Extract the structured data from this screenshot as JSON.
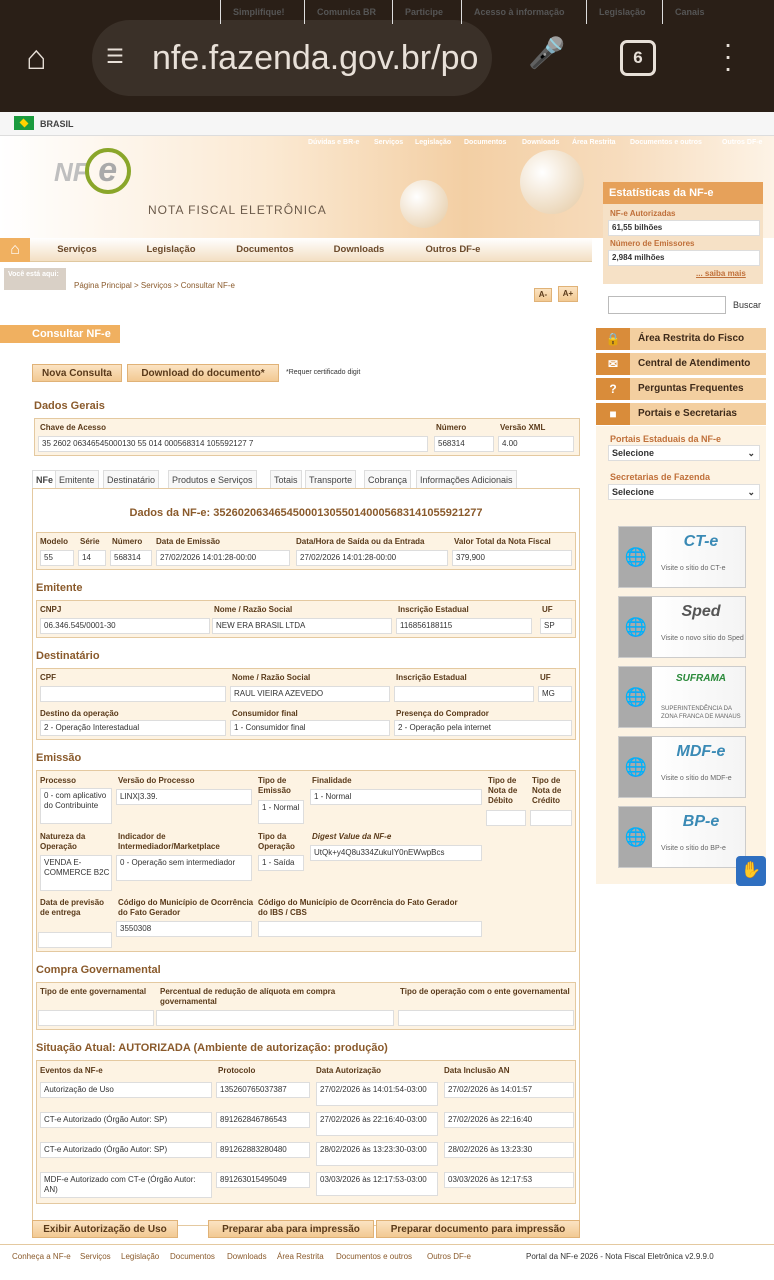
{
  "browser": {
    "url": "nfe.fazenda.gov.br/po",
    "tab_count": "6"
  },
  "govbar": {
    "country": "BRASIL",
    "links": [
      "Simplifique!",
      "Comunica BR",
      "Participe",
      "Acesso à informação",
      "Legislação",
      "Canais"
    ]
  },
  "toplinks": [
    "Dúvidas e BR-e",
    "Serviços",
    "Legislação",
    "Documentos",
    "Downloads",
    "Área Restrita",
    "Documentos e outros",
    "Outros DF-e"
  ],
  "logo": {
    "mark": "NF",
    "mark2": "e",
    "subtitle": "NOTA FISCAL ELETRÔNICA"
  },
  "stats": {
    "title": "Estatísticas da NF-e",
    "auth_label": "NF-e Autorizadas",
    "auth_value": "61,55 bilhões",
    "emit_label": "Número de Emissores",
    "emit_value": "2,984 milhões",
    "more": "... saiba mais"
  },
  "nav": [
    "Serviços",
    "Legislação",
    "Documentos",
    "Downloads",
    "Outros DF-e"
  ],
  "breadcrumb": {
    "here": "Você está aqui:",
    "path": "Página Principal > Serviços > Consultar NF-e"
  },
  "font": {
    "dec": "A-",
    "inc": "A+"
  },
  "search": {
    "placeholder": "",
    "button": "Buscar"
  },
  "page_title": "Consultar NF-e",
  "actions": {
    "new": "Nova Consulta",
    "download": "Download do documento*",
    "note": "*Requer certificado digit"
  },
  "gerais": {
    "title": "Dados Gerais",
    "chave_lbl": "Chave de Acesso",
    "chave": "35 2602 06346545000130 55 014 000568314 105592127 7",
    "numero_lbl": "Número",
    "numero": "568314",
    "versao_lbl": "Versão XML",
    "versao": "4.00"
  },
  "tabs": [
    "NFe",
    "Emitente",
    "Destinatário",
    "Produtos e Serviços",
    "Totais",
    "Transporte",
    "Cobrança",
    "Informações Adicionais"
  ],
  "nfe": {
    "title": "Dados da NF-e: 35260206346545000130550140005683141055921277",
    "cols": [
      "Modelo",
      "Série",
      "Número",
      "Data de Emissão",
      "Data/Hora de Saída ou da Entrada",
      "Valor Total da Nota Fiscal"
    ],
    "vals": [
      "55",
      "14",
      "568314",
      "27/02/2026 14:01:28-00:00",
      "27/02/2026 14:01:28-00:00",
      "379,900"
    ]
  },
  "emitente": {
    "title": "Emitente",
    "cols": [
      "CNPJ",
      "Nome / Razão Social",
      "Inscrição Estadual",
      "UF"
    ],
    "vals": [
      "06.346.545/0001-30",
      "NEW ERA BRASIL LTDA",
      "116856188115",
      "SP"
    ]
  },
  "destinatario": {
    "title": "Destinatário",
    "c1": "CPF",
    "c2": "Nome / Razão Social",
    "c3": "Inscrição Estadual",
    "c4": "UF",
    "v1": "",
    "v2": "RAUL VIEIRA AZEVEDO",
    "v3": "",
    "v4": "MG",
    "d1": "Destino da operação",
    "d2": "Consumidor final",
    "d3": "Presença do Comprador",
    "e1": "2 - Operação Interestadual",
    "e2": "1 - Consumidor final",
    "e3": "2 - Operação pela internet"
  },
  "emissao": {
    "title": "Emissão",
    "processo_lbl": "Processo",
    "processo": "0 - com aplicativo do Contribuinte",
    "versao_lbl": "Versão do Processo",
    "versao": "LINX|3.39.",
    "tipo_lbl": "Tipo de Emissão",
    "tipo": "1 - Normal",
    "final_lbl": "Finalidade",
    "final": "1 - Normal",
    "debito_lbl": "Tipo de Nota de Débito",
    "credito_lbl": "Tipo de Nota de Crédito",
    "natureza_lbl": "Natureza da Operação",
    "natureza": "VENDA E-COMMERCE B2C",
    "indic_lbl": "Indicador de Intermediador/Marketplace",
    "indic": "0 - Operação sem intermediador",
    "tipoop_lbl": "Tipo da Operação",
    "tipoop": "1 - Saída",
    "digest_lbl": "Digest Value da NF-e",
    "digest": "UtQk+y4Q8u334ZukuIY0nEWwpBcs",
    "prev_lbl": "Data de previsão de entrega",
    "mun_lbl": "Código do Município de Ocorrência do Fato Gerador",
    "mun": "3550308",
    "ibs_lbl": "Código do Município de Ocorrência do Fato Gerador do IBS / CBS"
  },
  "compra": {
    "title": "Compra Governamental",
    "c1": "Tipo de ente governamental",
    "c2": "Percentual de redução de alíquota em compra governamental",
    "c3": "Tipo de operação com o ente governamental"
  },
  "situacao": {
    "title": "Situação Atual: AUTORIZADA (Ambiente de autorização: produção)",
    "cols": [
      "Eventos da NF-e",
      "Protocolo",
      "Data Autorização",
      "Data Inclusão AN"
    ],
    "rows": [
      [
        "Autorização de Uso",
        "135260765037387",
        "27/02/2026 às 14:01:54-03:00",
        "27/02/2026 às 14:01:57"
      ],
      [
        "CT-e Autorizado (Órgão Autor: SP)",
        "891262846786543",
        "27/02/2026 às 22:16:40-03:00",
        "27/02/2026 às 22:16:40"
      ],
      [
        "CT-e Autorizado (Órgão Autor: SP)",
        "891262883280480",
        "28/02/2026 às 13:23:30-03:00",
        "28/02/2026 às 13:23:30"
      ],
      [
        "MDF-e Autorizado com CT-e (Órgão Autor: AN)",
        "891263015495049",
        "03/03/2026 às 12:17:53-03:00",
        "03/03/2026 às 12:17:53"
      ]
    ]
  },
  "bottom": {
    "b1": "Exibir Autorização de Uso",
    "b2": "Preparar aba para impressão",
    "b3": "Preparar documento para impressão"
  },
  "sidebar": {
    "restrita": "Área Restrita do Fisco",
    "central": "Central de Atendimento",
    "perguntas": "Perguntas Frequentes",
    "portais": "Portais e Secretarias",
    "portais_lbl": "Portais Estaduais da NF-e",
    "secretarias_lbl": "Secretarias de Fazenda",
    "select": "Selecione"
  },
  "ads": [
    {
      "logo": "CT-e",
      "cap": "Visite o sítio do CT-e"
    },
    {
      "logo": "Sped",
      "cap": "Visite o novo sítio do Sped"
    },
    {
      "logo": "SUFRAMA",
      "cap": "SUPERINTENDÊNCIA DA ZONA FRANCA DE MANAUS"
    },
    {
      "logo": "MDF-e",
      "cap": "Visite o sítio do MDF-e"
    },
    {
      "logo": "BP-e",
      "cap": "Visite o sítio do BP-e"
    }
  ],
  "footer": {
    "links": [
      "Conheça a NF-e",
      "Serviços",
      "Legislação",
      "Documentos",
      "Downloads",
      "Área Restrita",
      "Documentos e outros",
      "Outros DF-e"
    ],
    "right": "Portal da NF-e 2026 - Nota Fiscal Eletrônica v2.9.9.0"
  }
}
